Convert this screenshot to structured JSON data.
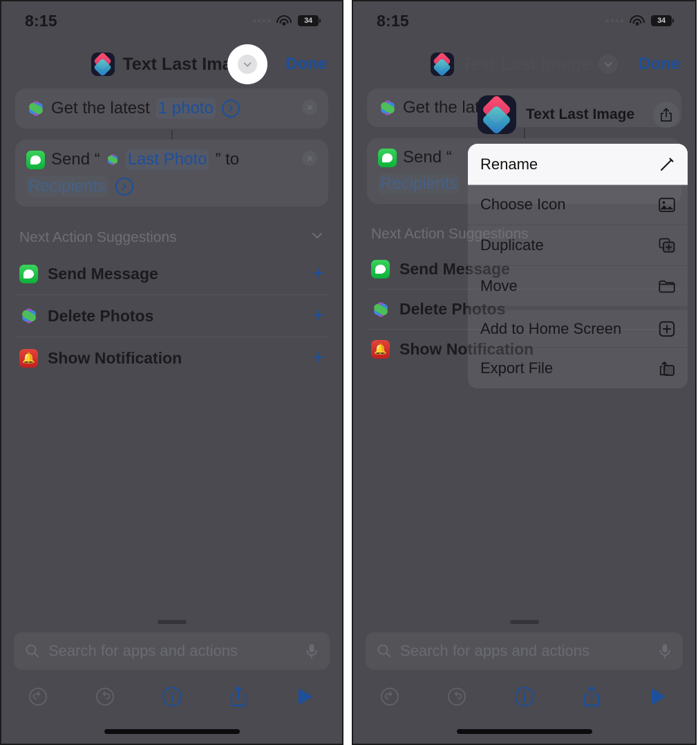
{
  "status": {
    "time": "8:15",
    "battery_level": "34",
    "wifi_icon": "wifi-icon",
    "signal_icon": "cellular-signal-icon"
  },
  "nav": {
    "title": "Text Last Image",
    "done_label": "Done",
    "chevron_icon": "chevron-down-icon",
    "shortcut_icon": "shortcuts-app-icon"
  },
  "actions": [
    {
      "app_icon": "photos-app-icon",
      "prefix": "Get the latest",
      "param": "1 photo",
      "param_icon": "chevron-right-circle-icon",
      "remove_icon": "remove-action-icon"
    },
    {
      "app_icon": "messages-app-icon",
      "prefix": "Send “",
      "inline_icon": "photos-app-icon",
      "param": "Last Photo",
      "suffix": "” to",
      "param2": "Recipients",
      "param2_icon": "chevron-right-circle-icon",
      "remove_icon": "remove-action-icon"
    }
  ],
  "suggestions": {
    "title": "Next Action Suggestions",
    "collapse_icon": "chevron-down-icon",
    "items": [
      {
        "label": "Send Message",
        "app_icon": "messages-app-icon",
        "add_icon": "plus-icon",
        "add_label": "+"
      },
      {
        "label": "Delete Photos",
        "app_icon": "photos-app-icon",
        "add_icon": "plus-icon",
        "add_label": "+"
      },
      {
        "label": "Show Notification",
        "app_icon": "notifications-app-icon",
        "add_icon": "plus-icon",
        "add_label": "+"
      }
    ]
  },
  "search": {
    "placeholder": "Search for apps and actions",
    "search_icon": "search-icon",
    "mic_icon": "microphone-icon"
  },
  "toolbar": {
    "undo_icon": "undo-icon",
    "redo_icon": "redo-icon",
    "info_icon": "info-circle-icon",
    "share_icon": "share-icon",
    "play_icon": "play-icon"
  },
  "context_menu": {
    "header_title": "Text Last Image",
    "header_icon": "shortcuts-app-icon",
    "header_share_icon": "share-icon",
    "items": [
      {
        "label": "Rename",
        "icon": "pencil-icon",
        "highlighted": true
      },
      {
        "label": "Choose Icon",
        "icon": "photo-icon",
        "highlighted": false
      },
      {
        "label": "Duplicate",
        "icon": "duplicate-icon",
        "highlighted": false
      },
      {
        "label": "Move",
        "icon": "folder-icon",
        "highlighted": false
      },
      {
        "label": "Add to Home Screen",
        "icon": "plus-square-icon",
        "highlighted": false
      },
      {
        "label": "Export File",
        "icon": "export-icon",
        "highlighted": false
      }
    ]
  },
  "colors": {
    "background": "#4a4a50",
    "accent_blue": "#1d4f9c",
    "text_dark": "#1b1b1e",
    "muted": "#6e6e75"
  }
}
